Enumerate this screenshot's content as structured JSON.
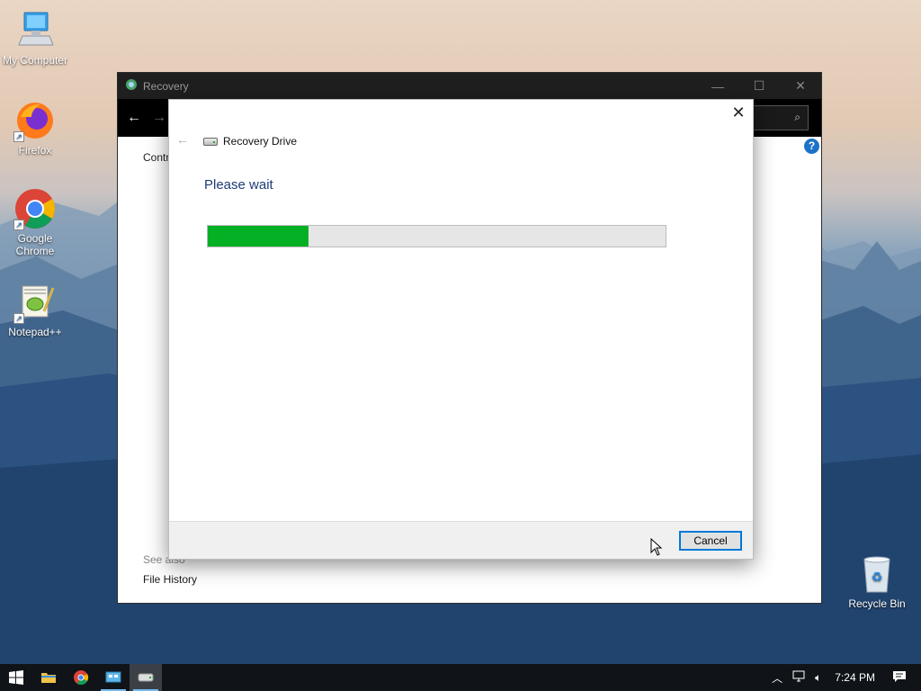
{
  "desktop": {
    "icons": [
      {
        "label": "My Computer",
        "icon": "computer-icon"
      },
      {
        "label": "Firefox",
        "icon": "firefox-icon"
      },
      {
        "label": "Google Chrome",
        "icon": "chrome-icon"
      },
      {
        "label": "Notepad++",
        "icon": "notepadpp-icon"
      },
      {
        "label": "Recycle Bin",
        "icon": "recycle-bin-icon"
      }
    ]
  },
  "explorer": {
    "title": "Recovery",
    "control_label": "Contr",
    "see_also": "See also",
    "file_history": "File History",
    "help": "?"
  },
  "dialog": {
    "title": "Recovery Drive",
    "heading": "Please wait",
    "progress_percent": 22,
    "cancel_label": "Cancel"
  },
  "taskbar": {
    "items": [
      "start",
      "file-explorer",
      "chrome",
      "control-panel",
      "recovery-drive"
    ],
    "clock": "7:24 PM"
  },
  "colors": {
    "progress_fill": "#06b025",
    "accent": "#0078d7",
    "heading": "#1e3c78"
  }
}
